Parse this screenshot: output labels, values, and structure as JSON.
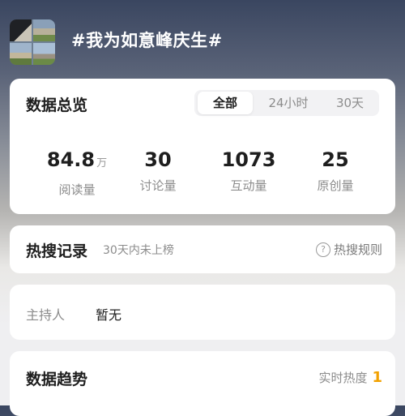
{
  "topic": {
    "title": "#我为如意峰庆生#"
  },
  "overview": {
    "title": "数据总览",
    "tabs": [
      "全部",
      "24小时",
      "30天"
    ],
    "active_tab": "全部",
    "stats": [
      {
        "value": "84.8",
        "unit": "万",
        "label": "阅读量"
      },
      {
        "value": "30",
        "unit": "",
        "label": "讨论量"
      },
      {
        "value": "1073",
        "unit": "",
        "label": "互动量"
      },
      {
        "value": "25",
        "unit": "",
        "label": "原创量"
      }
    ]
  },
  "hot_search": {
    "title": "热搜记录",
    "subtitle": "30天内未上榜",
    "rule_icon": "help-circle-icon",
    "rule_label": "热搜规则"
  },
  "host": {
    "label": "主持人",
    "value": "暂无"
  },
  "trend": {
    "title": "数据趋势",
    "heat_label": "实时热度",
    "heat_value": "1"
  },
  "colors": {
    "accent_heat": "#f2a100",
    "card_bg": "#ffffff"
  }
}
